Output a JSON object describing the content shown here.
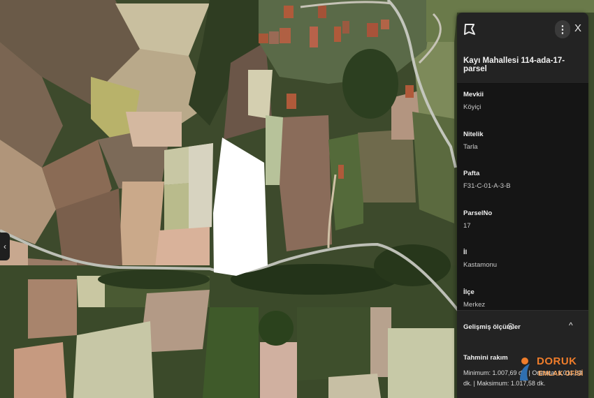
{
  "map": {
    "collapse_glyph": "‹",
    "road_color": "#b9bdb4",
    "parcel_color": "#ffffff"
  },
  "panel": {
    "logo_icon": "parcel-polygon-icon",
    "more_glyph": "⋮",
    "close_glyph": "X",
    "title": "Kayı Mahallesi 114-ada-17-parsel",
    "fields": [
      {
        "label": "Mevkii",
        "value": "Köyiçi"
      },
      {
        "label": "Nitelik",
        "value": "Tarla"
      },
      {
        "label": "Pafta",
        "value": "F31-C-01-A-3-B"
      },
      {
        "label": "ParselNo",
        "value": "17"
      },
      {
        "label": "İl",
        "value": "Kastamonu"
      },
      {
        "label": "İlçe",
        "value": "Merkez"
      }
    ],
    "advanced": {
      "title": "Gelişmiş ölçümler",
      "info_glyph": "i",
      "chevron_glyph": "^",
      "subtitle": "Tahmini rakım",
      "line1": "Minimum: 1.007,69 dk. | Ortanca: 1.011,63",
      "line2": "dk. | Maksimum: 1.017,58 dk."
    }
  },
  "watermark": {
    "brand_top": "DORUK",
    "brand_bottom": "EMLAK OFİSİ"
  }
}
